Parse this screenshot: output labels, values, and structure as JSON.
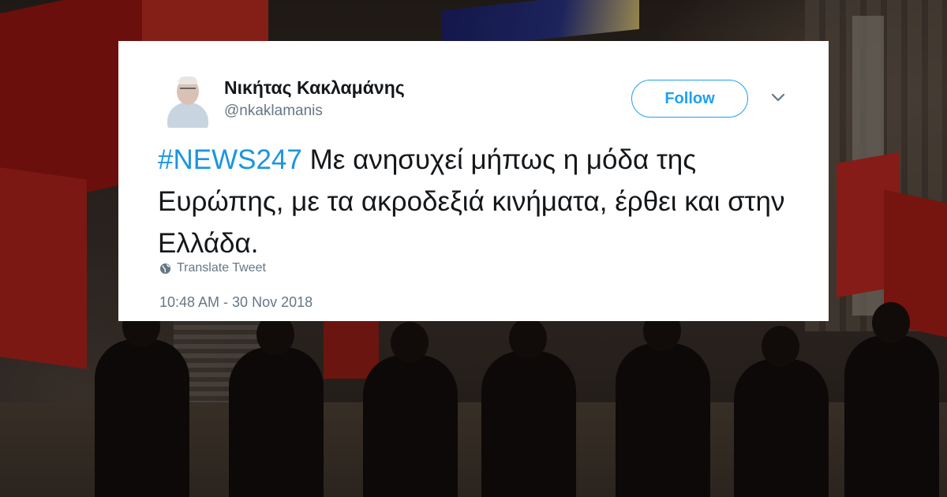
{
  "tweet": {
    "author_name": "Νικήτας Κακλαμάνης",
    "author_handle": "@nkaklamanis",
    "follow_label": "Follow",
    "hashtag": "#NEWS247",
    "text": " Με ανησυχεί μήπως η μόδα της Ευρώπης, με τα ακροδεξιά κινήματα, έρθει και στην Ελλάδα.",
    "translate_label": "Translate Tweet",
    "timestamp": "10:48 AM - 30 Nov 2018"
  },
  "icons": {
    "caret": "chevron-down-icon",
    "translate": "globe-icon",
    "avatar": "avatar"
  },
  "colors": {
    "accent": "#1da1f2",
    "hashtag": "#1b95e0",
    "text": "#14171a",
    "secondary": "#657786",
    "flag_red": "#a21a16"
  }
}
